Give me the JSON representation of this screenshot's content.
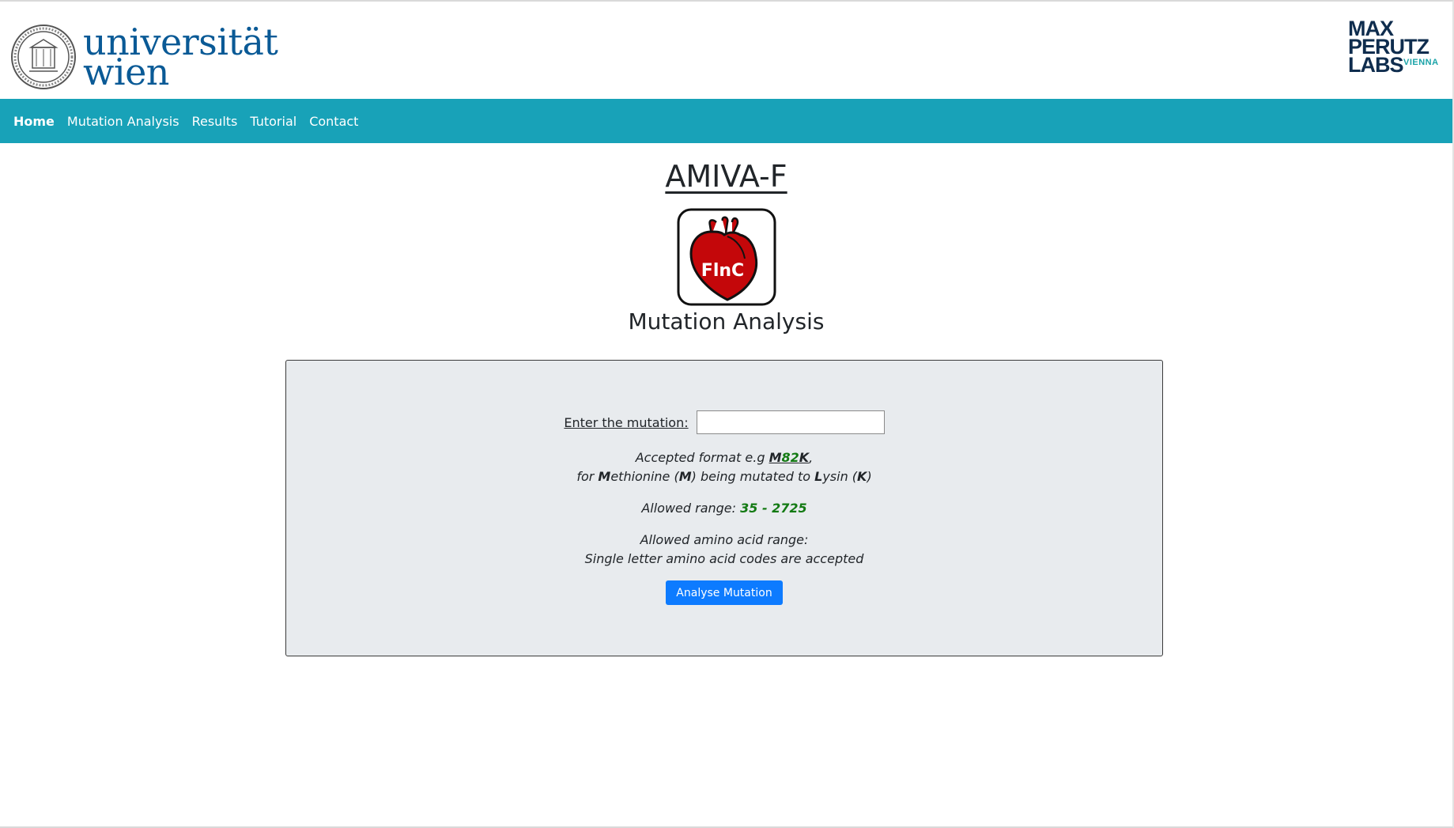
{
  "header": {
    "university_logo_line1": "universität",
    "university_logo_line2": "wien",
    "institute_logo_line1": "MAX",
    "institute_logo_line2": "PERUTZ",
    "institute_logo_line3": "LABS",
    "institute_logo_suffix": "VIENNA"
  },
  "nav": {
    "items": [
      {
        "label": "Home",
        "active": true
      },
      {
        "label": "Mutation Analysis",
        "active": false
      },
      {
        "label": "Results",
        "active": false
      },
      {
        "label": "Tutorial",
        "active": false
      },
      {
        "label": "Contact",
        "active": false
      }
    ],
    "background_color": "#18a2b8"
  },
  "main": {
    "title": "AMIVA-F",
    "logo_text": "FlnC",
    "subtitle": "Mutation Analysis"
  },
  "form": {
    "label": "Enter the mutation:",
    "input_value": "",
    "format_prefix": "Accepted format e.g ",
    "format_example": {
      "from": "M",
      "position": "82",
      "to": "K"
    },
    "format_comma": ",",
    "format_expl": {
      "p1": "for ",
      "b1": "M",
      "p2": "ethionine (",
      "b2": "M",
      "p3": ") being mutated to ",
      "b3": "L",
      "p4": "ysin (",
      "b4": "K",
      "p5": ")"
    },
    "range_label": "Allowed range: ",
    "range_value": "35 - 2725",
    "aa_range_label": "Allowed amino acid range:",
    "aa_range_text": "Single letter amino acid codes are accepted",
    "submit_label": "Analyse Mutation",
    "accent_color": "#137a13",
    "button_color": "#0d7bff"
  }
}
